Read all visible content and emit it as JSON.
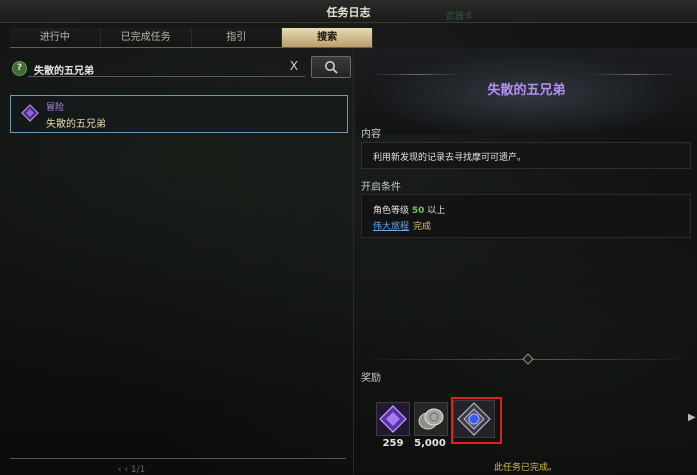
{
  "window": {
    "title": "任务日志",
    "ghost_text": "武器卡"
  },
  "tabs": [
    {
      "label": "进行中"
    },
    {
      "label": "已完成任务"
    },
    {
      "label": "指引"
    },
    {
      "label": "搜索"
    }
  ],
  "search": {
    "help": "?",
    "query": "失散的五兄弟",
    "clear": "X"
  },
  "results": [
    {
      "category": "冒险",
      "name": "失散的五兄弟"
    }
  ],
  "pager": {
    "text": "‹ ‹  1/1"
  },
  "detail": {
    "title": "失散的五兄弟",
    "content_label": "内容",
    "content_text": "利用新发现的记录去寻找摩可可遗产。",
    "condition_label": "开启条件",
    "level_prefix": "角色等级",
    "level_value": "50",
    "level_suffix": "以上",
    "prereq_quest": "伟大旅程",
    "prereq_status": "完成",
    "reward_label": "奖励",
    "rewards": [
      {
        "icon": "purple-gem-icon",
        "count": "259"
      },
      {
        "icon": "silver-coin-icon",
        "count": "5,000"
      },
      {
        "icon": "blue-crystal-emblem-icon",
        "count": ""
      }
    ],
    "complete_text": "此任务已完成。"
  },
  "colors": {
    "accent_purple": "#b590f3",
    "active_tab": "#e9dbb5",
    "highlight_red": "#e02020",
    "level_green": "#71c14a",
    "link_blue": "#69a8ef"
  }
}
